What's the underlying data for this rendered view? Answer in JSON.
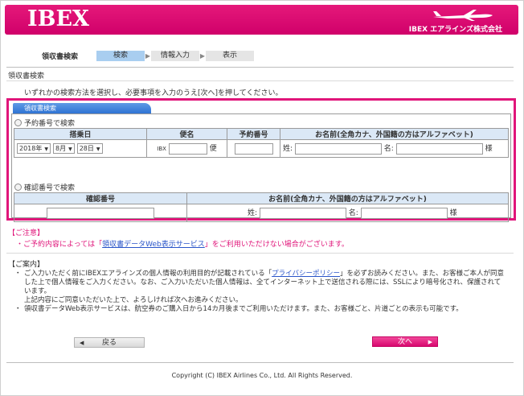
{
  "header": {
    "logo": "IBEX",
    "company": "IBEX エアラインズ株式会社"
  },
  "steps": {
    "title": "領収書検索",
    "items": [
      "検索",
      "情報入力",
      "表示"
    ]
  },
  "page_title": "領収書検索",
  "instruction": "いずれかの検索方法を選択し、必要事項を入力のうえ[次へ]を押してください。",
  "form": {
    "tab_label": "領収書検索",
    "reservation": {
      "radio_label": "予約番号で検索",
      "headers": [
        "搭乗日",
        "便名",
        "予約番号",
        "お名前(全角カナ、外国籍の方はアルファベット)"
      ],
      "year": "2018年",
      "month": "8月",
      "day": "28日",
      "flight_prefix": "IBX",
      "flight_suffix": "便",
      "surname_label": "姓:",
      "given_label": "名:",
      "honorific": "様"
    },
    "confirmation": {
      "radio_label": "確認番号で検索",
      "headers": [
        "確認番号",
        "お名前(全角カナ、外国籍の方はアルファベット)"
      ],
      "surname_label": "姓:",
      "given_label": "名:",
      "honorific": "様"
    }
  },
  "caution": {
    "title": "【ご注意】",
    "text_before": "ご予約内容によっては「",
    "link": "領収書データWeb表示サービス",
    "text_after": "」をご利用いただけない場合がございます。"
  },
  "info": {
    "title": "【ご案内】",
    "item1_before": "ご入力いただく前にIBEXエアラインズの個人情報の利用目的が記載されている「",
    "item1_link": "プライバシーポリシー",
    "item1_after": "」を必ずお読みください。また、お客様ご本人が同意した上で個人情報をご入力ください。なお、ご入力いただいた個人情報は、全てインターネット上で送信される際には、SSLにより暗号化され、保護されています。",
    "item1_line2": "上記内容にご同意いただいた上で、よろしければ次へお進みください。",
    "item2": "領収書データWeb表示サービスは、航空券のご購入日から14カ月後までご利用いただけます。また、お客様ごと、片道ごとの表示も可能です。"
  },
  "buttons": {
    "back": "戻る",
    "next": "次へ"
  },
  "footer": {
    "copyright": "Copyright (C) IBEX Airlines Co., Ltd. All Rights Reserved."
  },
  "colors": {
    "brand_pink": "#e0157a",
    "tab_blue": "#2f73d4",
    "header_cell": "#dbe8f6"
  }
}
